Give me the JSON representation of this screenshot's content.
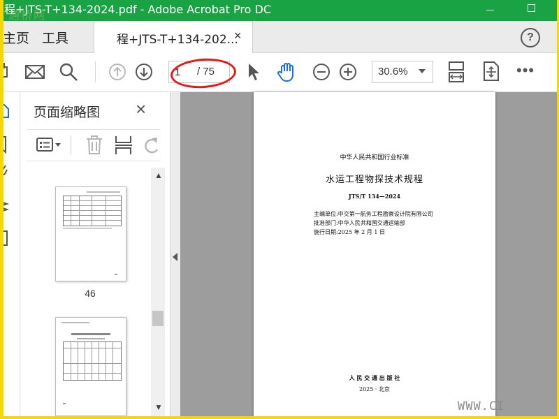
{
  "window": {
    "title": "程+JTS-T+134-2024.pdf - Adobe Acrobat Pro DC",
    "watermark": "通桥网"
  },
  "menu": {
    "home_label": "主页",
    "tools_label": "工具",
    "tab_label": "程+JTS-T+134-202...",
    "tab_close": "×",
    "help_label": "?"
  },
  "toolbar": {
    "page_current": "1",
    "page_total": "/ 75",
    "zoom_value": "30.6%",
    "more_label": "•••"
  },
  "thumbnail_panel": {
    "title": "页面缩略图",
    "close_label": "×",
    "thumbnails": [
      {
        "page_label": "46"
      }
    ]
  },
  "document_page": {
    "standard_type": "中华人民共和国行业标准",
    "title": "水运工程物探技术规程",
    "code": "JTS/T 134—2024",
    "info_lines": [
      "主编单位:中交第一航务工程勘察设计院有限公司",
      "批准部门:中华人民共和国交通运输部",
      "施行日期:2025 年 2 月 1 日"
    ],
    "publisher": "人 民 交 通 出 版 社",
    "pub_place_date": "2025 · 北京"
  },
  "site_watermark": "WWW.CI",
  "colors": {
    "titlebar": "#1aa345",
    "border": "#f5d800",
    "annotation": "#e31a1a",
    "hand_tool": "#1c6fd6"
  }
}
